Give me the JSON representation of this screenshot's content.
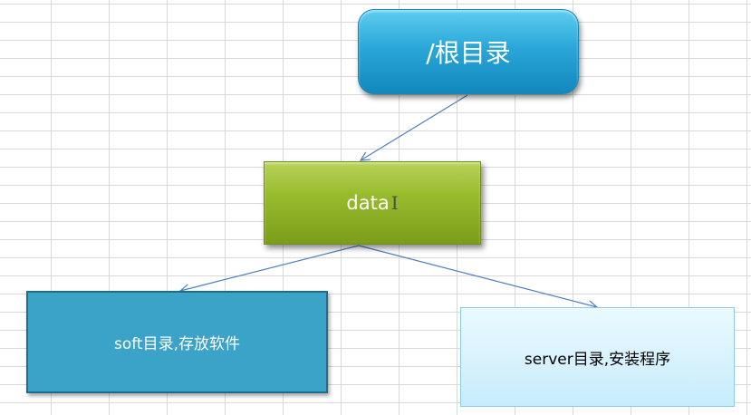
{
  "diagram": {
    "nodes": {
      "root": {
        "label": "/根目录",
        "color": "#2aa7d8"
      },
      "data": {
        "label": "data",
        "color": "#98bb2c"
      },
      "soft": {
        "label": "soft目录,存放软件",
        "color": "#3ba3c8"
      },
      "server": {
        "label": "server目录,安装程序",
        "color": "#c7ecfb"
      }
    },
    "edges": [
      {
        "from": "root",
        "to": "data"
      },
      {
        "from": "data",
        "to": "soft"
      },
      {
        "from": "data",
        "to": "server"
      }
    ],
    "edge_color": "#4f7fbf",
    "grid_color": "#d9d9d9"
  }
}
